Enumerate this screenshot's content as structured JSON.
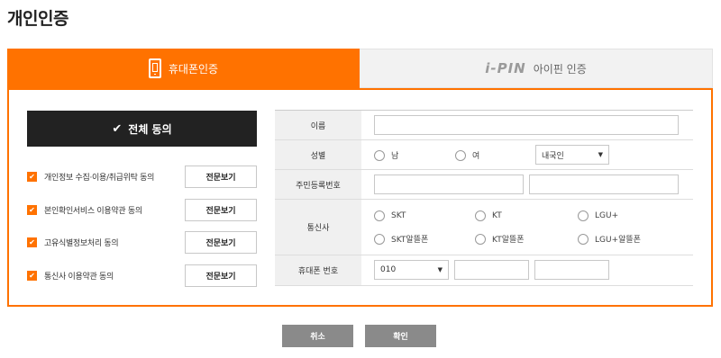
{
  "page": {
    "title": "개인인증"
  },
  "tabs": [
    {
      "label": "휴대폰인증",
      "icon": "phone-icon",
      "active": true
    },
    {
      "logo": "i-PIN",
      "label": "아이핀 인증",
      "icon": "ipin-logo",
      "active": false
    }
  ],
  "colors": {
    "accent": "#ff7200",
    "dark": "#222222",
    "button_gray": "#8a8a8a"
  },
  "agree_all": {
    "label": "전체 동의",
    "icon": "check-icon"
  },
  "terms": [
    {
      "label": "개인정보 수집·이용/취급위탁 동의",
      "button": "전문보기",
      "checked": true
    },
    {
      "label": "본인확인서비스 이용약관 동의",
      "button": "전문보기",
      "checked": true
    },
    {
      "label": "고유식별정보처리 동의",
      "button": "전문보기",
      "checked": true
    },
    {
      "label": "통신사 이용약관 동의",
      "button": "전문보기",
      "checked": true
    }
  ],
  "form": {
    "name_label": "이름",
    "name_value": "",
    "gender_label": "성별",
    "gender_options": [
      "남",
      "여"
    ],
    "nationality_value": "내국인",
    "rrn_label": "주민등록번호",
    "rrn_first": "",
    "rrn_second": "",
    "carrier_label": "통신사",
    "carriers": [
      "SKT",
      "KT",
      "LGU+",
      "SKT알뜰폰",
      "KT알뜰폰",
      "LGU+알뜰폰"
    ],
    "phone_label": "휴대폰 번호",
    "phone_prefix": "010",
    "phone_middle": "",
    "phone_last": ""
  },
  "actions": {
    "cancel": "취소",
    "confirm": "확인"
  }
}
